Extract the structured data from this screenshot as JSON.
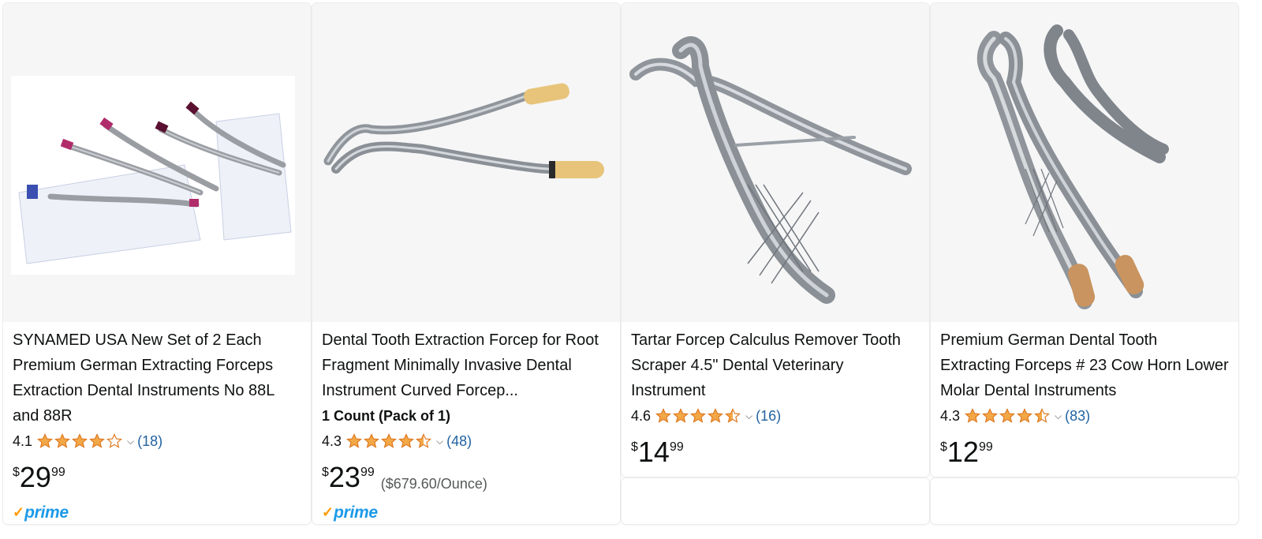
{
  "colors": {
    "star": "#f3a847",
    "link": "#2162a1",
    "prime_check": "#ff9900",
    "prime_text": "#1c9ae8"
  },
  "products": [
    {
      "title": "SYNAMED USA New Set of 2 Each Premium German Extracting Forceps Extraction Dental Instruments No 88L and 88R",
      "image_icon": "dental-forceps-set-image",
      "rating": "4.1",
      "stars": 4.1,
      "review_count": "(18)",
      "price": {
        "currency": "$",
        "whole": "29",
        "fraction": "99"
      },
      "prime": true
    },
    {
      "title": "Dental Tooth Extraction Forcep for Root Fragment Minimally Invasive Dental Instrument Curved Forcep...",
      "count_label": "1 Count (Pack of 1)",
      "image_icon": "curved-forcep-image",
      "rating": "4.3",
      "stars": 4.5,
      "review_count": "(48)",
      "price": {
        "currency": "$",
        "whole": "23",
        "fraction": "99",
        "unit_price": "($679.60/Ounce)"
      },
      "prime": true
    },
    {
      "title": "Tartar Forcep Calculus Remover Tooth Scraper 4.5\" Dental Veterinary Instrument",
      "image_icon": "tartar-forcep-image",
      "rating": "4.6",
      "stars": 4.5,
      "review_count": "(16)",
      "price": {
        "currency": "$",
        "whole": "14",
        "fraction": "99"
      },
      "prime": false
    },
    {
      "title": "Premium German Dental Tooth Extracting Forceps # 23 Cow Horn Lower Molar Dental Instruments",
      "image_icon": "cow-horn-forceps-image",
      "rating": "4.3",
      "stars": 4.5,
      "review_count": "(83)",
      "price": {
        "currency": "$",
        "whole": "12",
        "fraction": "99"
      },
      "prime": false
    }
  ],
  "prime_label": {
    "check": "✓",
    "text": "prime"
  }
}
